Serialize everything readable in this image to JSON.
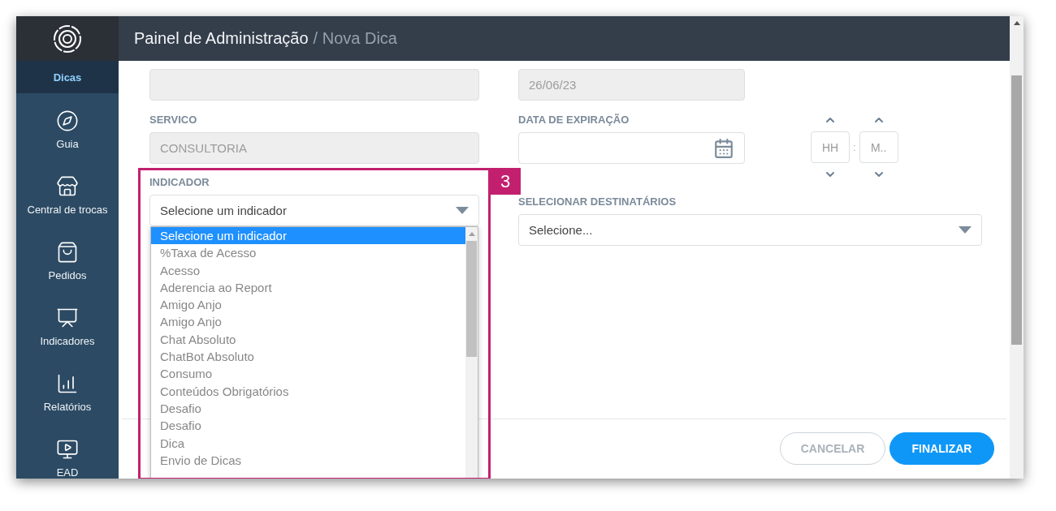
{
  "sidebar": {
    "items": [
      {
        "label": "Dicas",
        "selected": true
      },
      {
        "label": "Guia",
        "selected": false
      },
      {
        "label": "Central de trocas",
        "selected": false
      },
      {
        "label": "Pedidos",
        "selected": false
      },
      {
        "label": "Indicadores",
        "selected": false
      },
      {
        "label": "Relatórios",
        "selected": false
      },
      {
        "label": "EAD",
        "selected": false
      }
    ]
  },
  "header": {
    "title": "Painel de Administração",
    "crumb": "/ Nova Dica"
  },
  "form": {
    "nome": {
      "disabled": true
    },
    "data_criacao": {
      "value": "26/06/23",
      "disabled": true
    },
    "servico": {
      "label": "SERVICO",
      "value": "CONSULTORIA",
      "disabled": true
    },
    "data_expiracao": {
      "label": "DATA DE EXPIRAÇÃO"
    },
    "hour": {
      "placeholder": "HH"
    },
    "separator": ":",
    "minute": {
      "placeholder": "M.."
    },
    "indicador": {
      "label": "INDICADOR",
      "value": "Selecione um indicador",
      "expanded": true,
      "options": [
        {
          "label": "Selecione um indicador",
          "selected": true
        },
        {
          "label": "%Taxa de Acesso",
          "selected": false
        },
        {
          "label": "Acesso",
          "selected": false
        },
        {
          "label": "Aderencia ao Report",
          "selected": false
        },
        {
          "label": "Amigo Anjo",
          "selected": false
        },
        {
          "label": "Amigo Anjo",
          "selected": false
        },
        {
          "label": "Chat Absoluto",
          "selected": false
        },
        {
          "label": "ChatBot Absoluto",
          "selected": false
        },
        {
          "label": "Consumo",
          "selected": false
        },
        {
          "label": "Conteúdos Obrigatórios",
          "selected": false
        },
        {
          "label": "Desafio",
          "selected": false
        },
        {
          "label": "Desafio",
          "selected": false
        },
        {
          "label": "Dica",
          "selected": false
        },
        {
          "label": "Envio de Dicas",
          "selected": false
        }
      ]
    },
    "destinatarios": {
      "label": "SELECIONAR DESTINATÁRIOS",
      "value": "Selecione..."
    }
  },
  "buttons": [
    {
      "label": "CANCELAR",
      "kind": "secondary"
    },
    {
      "label": "FINALIZAR",
      "kind": "primary"
    }
  ],
  "annotation": {
    "number": "3"
  }
}
